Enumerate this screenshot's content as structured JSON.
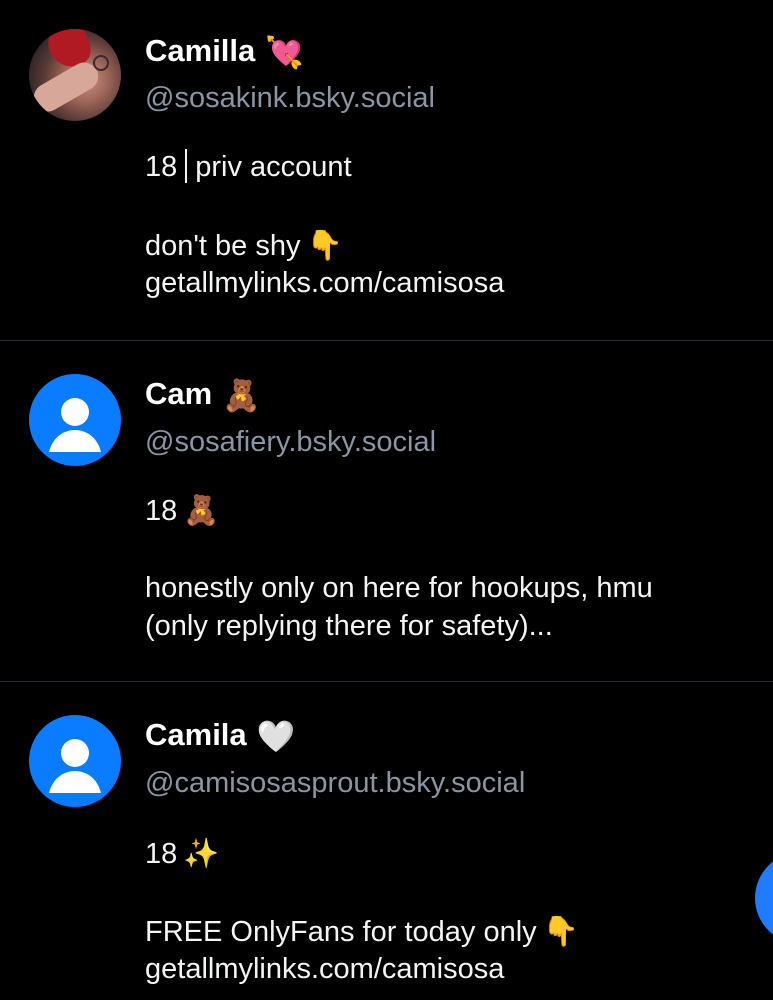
{
  "accounts": [
    {
      "name": "Camilla",
      "emoji": "💘",
      "emoji_icon": "heart-with-arrow-icon",
      "handle": "@sosakink.bsky.social",
      "bio_lines": [
        "18",
        "priv account",
        "don't be shy",
        "getallmylinks.com/camisosa"
      ],
      "bio_emojis": [
        "👇"
      ],
      "avatar": "photo"
    },
    {
      "name": "Cam",
      "emoji": "🧸",
      "emoji_icon": "teddy-bear-icon",
      "handle": "@sosafiery.bsky.social",
      "bio_lines": [
        "18",
        "honestly only on here for hookups, hmu",
        "(only replying there for safety)..."
      ],
      "bio_emojis": [
        "🧸"
      ],
      "avatar": "default"
    },
    {
      "name": "Camila",
      "emoji": "🤍",
      "emoji_icon": "white-heart-icon",
      "handle": "@camisosasprout.bsky.social",
      "bio_lines": [
        "18",
        "FREE OnlyFans for today only",
        "getallmylinks.com/camisosa"
      ],
      "bio_emojis": [
        "✨",
        "👇"
      ],
      "avatar": "default"
    }
  ],
  "colors": {
    "background": "#000000",
    "text": "#ffffff",
    "handle": "#8b95a3",
    "divider": "#2a2f36",
    "default_avatar": "#0a7cff",
    "fab": "#1f7cff"
  }
}
